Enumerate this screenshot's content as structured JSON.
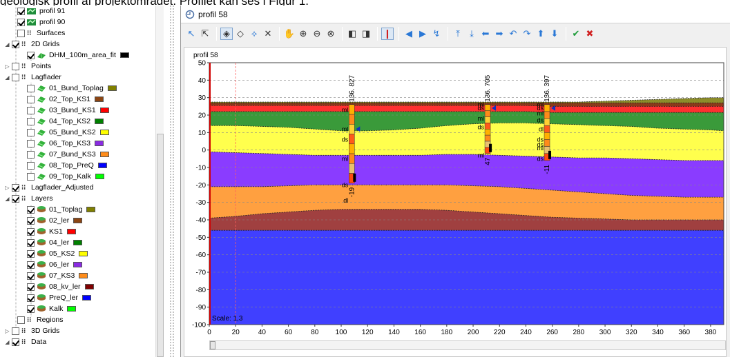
{
  "document": {
    "text": "geologisk profil af projektområdet. Profilet kan ses i Figur 1."
  },
  "tree": {
    "items": [
      {
        "key": "profil91",
        "label": "profil 91",
        "indent": 26,
        "checked": true,
        "icon": "profile-icon",
        "expander": ""
      },
      {
        "key": "profil90",
        "label": "profil 90",
        "indent": 26,
        "checked": true,
        "icon": "profile-icon",
        "expander": ""
      },
      {
        "key": "surfaces",
        "label": "Surfaces",
        "indent": 26,
        "checked": false,
        "icon": "folder-icon",
        "expander": ""
      },
      {
        "key": "grids2d",
        "label": "2D Grids",
        "indent": 18,
        "checked": true,
        "icon": "folder-icon",
        "expander": "◢"
      },
      {
        "key": "dhm",
        "label": "DHM_100m_area_fit",
        "indent": 40,
        "checked": true,
        "icon": "grid-icon",
        "expander": "",
        "swatch": "#000000"
      },
      {
        "key": "points",
        "label": "Points",
        "indent": 18,
        "checked": false,
        "icon": "folder-icon",
        "expander": "▷"
      },
      {
        "key": "lagflader",
        "label": "Lagflader",
        "indent": 18,
        "checked": false,
        "icon": "folder-icon",
        "expander": "◢"
      },
      {
        "key": "l01",
        "label": "01_Bund_Toplag",
        "indent": 40,
        "checked": false,
        "icon": "surface-icon",
        "expander": "",
        "swatch": "#808000"
      },
      {
        "key": "l02",
        "label": "02_Top_KS1",
        "indent": 40,
        "checked": false,
        "icon": "surface-icon",
        "expander": "",
        "swatch": "#8b4513"
      },
      {
        "key": "l03",
        "label": "03_Bund_KS1",
        "indent": 40,
        "checked": false,
        "icon": "surface-icon",
        "expander": "",
        "swatch": "#ff0000"
      },
      {
        "key": "l04",
        "label": "04_Top_KS2",
        "indent": 40,
        "checked": false,
        "icon": "surface-icon",
        "expander": "",
        "swatch": "#008000"
      },
      {
        "key": "l05",
        "label": "05_Bund_KS2",
        "indent": 40,
        "checked": false,
        "icon": "surface-icon",
        "expander": "",
        "swatch": "#ffff00"
      },
      {
        "key": "l06",
        "label": "06_Top_KS3",
        "indent": 40,
        "checked": false,
        "icon": "surface-icon",
        "expander": "",
        "swatch": "#8a2be2"
      },
      {
        "key": "l07",
        "label": "07_Bund_KS3",
        "indent": 40,
        "checked": false,
        "icon": "surface-icon",
        "expander": "",
        "swatch": "#ff8c1a"
      },
      {
        "key": "l08",
        "label": "08_Top_PreQ",
        "indent": 40,
        "checked": false,
        "icon": "surface-icon",
        "expander": "",
        "swatch": "#0000ff"
      },
      {
        "key": "l09",
        "label": "09_Top_Kalk",
        "indent": 40,
        "checked": false,
        "icon": "surface-icon",
        "expander": "",
        "swatch": "#00ff00"
      },
      {
        "key": "lagadj",
        "label": "Lagflader_Adjusted",
        "indent": 18,
        "checked": true,
        "icon": "folder-icon",
        "expander": "▷"
      },
      {
        "key": "layers",
        "label": "Layers",
        "indent": 18,
        "checked": true,
        "icon": "folder-icon",
        "expander": "◢"
      },
      {
        "key": "y01",
        "label": "01_Toplag",
        "indent": 40,
        "checked": true,
        "icon": "layer-icon",
        "expander": "",
        "swatch": "#808000"
      },
      {
        "key": "y02",
        "label": "02_ler",
        "indent": 40,
        "checked": true,
        "icon": "layer-icon",
        "expander": "",
        "swatch": "#8b4513"
      },
      {
        "key": "y03",
        "label": "KS1",
        "indent": 40,
        "checked": true,
        "icon": "layer-icon",
        "expander": "",
        "swatch": "#ff0000"
      },
      {
        "key": "y04",
        "label": "04_ler",
        "indent": 40,
        "checked": true,
        "icon": "layer-icon",
        "expander": "",
        "swatch": "#008000"
      },
      {
        "key": "y05",
        "label": "05_KS2",
        "indent": 40,
        "checked": true,
        "icon": "layer-icon",
        "expander": "",
        "swatch": "#ffff00"
      },
      {
        "key": "y06",
        "label": "06_ler",
        "indent": 40,
        "checked": true,
        "icon": "layer-icon",
        "expander": "",
        "swatch": "#8a2be2"
      },
      {
        "key": "y07",
        "label": "07_KS3",
        "indent": 40,
        "checked": true,
        "icon": "layer-icon",
        "expander": "",
        "swatch": "#ff8c1a"
      },
      {
        "key": "y08",
        "label": "08_kv_ler",
        "indent": 40,
        "checked": true,
        "icon": "layer-icon",
        "expander": "",
        "swatch": "#800000"
      },
      {
        "key": "y09",
        "label": "PreQ_ler",
        "indent": 40,
        "checked": true,
        "icon": "layer-icon",
        "expander": "",
        "swatch": "#0000ff"
      },
      {
        "key": "y10",
        "label": "Kalk",
        "indent": 40,
        "checked": true,
        "icon": "layer-icon",
        "expander": "",
        "swatch": "#00ff00"
      },
      {
        "key": "regions",
        "label": "Regions",
        "indent": 26,
        "checked": false,
        "icon": "folder-icon",
        "expander": ""
      },
      {
        "key": "grids3d",
        "label": "3D Grids",
        "indent": 18,
        "checked": false,
        "icon": "folder-icon",
        "expander": "▷"
      },
      {
        "key": "data",
        "label": "Data",
        "indent": 18,
        "checked": true,
        "icon": "folder-icon",
        "expander": "◢"
      }
    ]
  },
  "panel": {
    "title": "profil 58",
    "toolbar": [
      {
        "name": "select-arrow-icon",
        "glyph": "↖",
        "active": false
      },
      {
        "name": "select-detail-icon",
        "glyph": "⇱",
        "active": false
      },
      {
        "sep": true
      },
      {
        "name": "edit-node-icon",
        "glyph": "◈",
        "active": true
      },
      {
        "name": "add-node-icon",
        "glyph": "◇",
        "active": false
      },
      {
        "name": "move-node-icon",
        "glyph": "⟡",
        "active": false
      },
      {
        "name": "delete-icon",
        "glyph": "✕",
        "active": false
      },
      {
        "sep": true
      },
      {
        "name": "pan-hand-icon",
        "glyph": "✋",
        "active": false
      },
      {
        "name": "zoom-in-icon",
        "glyph": "⊕",
        "active": false
      },
      {
        "name": "zoom-out-icon",
        "glyph": "⊖",
        "active": false
      },
      {
        "name": "zoom-extent-icon",
        "glyph": "⊗",
        "active": false
      },
      {
        "sep": true
      },
      {
        "name": "previous-view-icon",
        "glyph": "◧",
        "active": false
      },
      {
        "name": "next-view-icon",
        "glyph": "◨",
        "active": false
      },
      {
        "sep": true
      },
      {
        "name": "borehole-toggle-icon",
        "glyph": "❙",
        "active": true
      },
      {
        "sep": true
      },
      {
        "name": "step-left-icon",
        "glyph": "◀",
        "active": false
      },
      {
        "name": "step-right-icon",
        "glyph": "▶",
        "active": false
      },
      {
        "name": "snap-icon",
        "glyph": "↯",
        "active": false
      },
      {
        "sep": true
      },
      {
        "name": "move-top-icon",
        "glyph": "⤒",
        "active": false
      },
      {
        "name": "move-bottom-icon",
        "glyph": "⤓",
        "active": false
      },
      {
        "name": "arrow-left-icon",
        "glyph": "⬅",
        "active": false
      },
      {
        "name": "arrow-right-icon",
        "glyph": "➡",
        "active": false
      },
      {
        "name": "undo-icon",
        "glyph": "↶",
        "active": false
      },
      {
        "name": "redo-icon",
        "glyph": "↷",
        "active": false
      },
      {
        "name": "arrow-up-icon",
        "glyph": "⬆",
        "active": false
      },
      {
        "name": "arrow-down-icon",
        "glyph": "⬇",
        "active": false
      },
      {
        "sep": true
      },
      {
        "name": "ok-icon",
        "glyph": "✔",
        "active": false
      },
      {
        "name": "cancel-icon",
        "glyph": "✖",
        "active": false
      }
    ]
  },
  "chart_data": {
    "type": "area",
    "title": "profil 58",
    "scale_label": "Scale: 1,3",
    "xlim": [
      0,
      390
    ],
    "ylim": [
      -100,
      50
    ],
    "xticks": [
      0,
      20,
      40,
      60,
      80,
      100,
      120,
      140,
      160,
      180,
      200,
      220,
      240,
      260,
      280,
      300,
      320,
      340,
      360,
      380
    ],
    "yticks": [
      50,
      40,
      30,
      20,
      10,
      0,
      -10,
      -20,
      -30,
      -40,
      -50,
      -60,
      -70,
      -80,
      -90,
      -100
    ],
    "grid": "dashed-horizontal",
    "x_profile": [
      0,
      20,
      40,
      60,
      80,
      100,
      120,
      140,
      160,
      180,
      200,
      220,
      240,
      260,
      280,
      300,
      320,
      340,
      360,
      380,
      390
    ],
    "layers": [
      {
        "name": "01_Toplag",
        "color": "#8c8c2a",
        "top": [
          27.5,
          27.5,
          27.5,
          27.5,
          27.5,
          27.5,
          27.5,
          27.5,
          27.5,
          27.5,
          27.5,
          27.5,
          27.5,
          27.5,
          27.5,
          28,
          28.5,
          29,
          29.5,
          30,
          30
        ]
      },
      {
        "name": "02_ler",
        "color": "#8b3a1a",
        "top": [
          27,
          27,
          27,
          27,
          27,
          27,
          27,
          27,
          27,
          27,
          27,
          27,
          27,
          27,
          27,
          27,
          27,
          27,
          27,
          27,
          27
        ]
      },
      {
        "name": "KS1",
        "color": "#ff3030",
        "top": [
          25.5,
          25.5,
          25.5,
          25.5,
          25.5,
          25.5,
          25.5,
          25.5,
          25.5,
          25.5,
          25.5,
          25.5,
          25.5,
          25,
          25,
          25,
          25,
          25,
          25,
          25,
          25
        ]
      },
      {
        "name": "04_ler",
        "color": "#3a9a3a",
        "top": [
          22,
          22,
          22,
          22,
          22,
          22,
          22,
          22,
          22,
          22,
          22,
          22,
          22,
          21.5,
          21.5,
          21.5,
          21.5,
          21.5,
          21.5,
          21.5,
          21.5
        ]
      },
      {
        "name": "05_KS2",
        "color": "#ffff4d",
        "top": [
          14,
          14,
          13.5,
          13,
          12,
          11,
          11,
          11.5,
          12.5,
          14,
          15,
          15.5,
          15.5,
          15,
          14.5,
          14,
          13.5,
          12.5,
          12,
          11.5,
          11
        ]
      },
      {
        "name": "06_ler",
        "color": "#8a3cff",
        "top": [
          -1,
          -1.5,
          -2,
          -2.5,
          -3,
          -3,
          -3,
          -3,
          -3,
          -2.5,
          -2.5,
          -3,
          -3.5,
          -4,
          -4.5,
          -4.5,
          -5,
          -5.5,
          -6,
          -6,
          -6
        ]
      },
      {
        "name": "07_KS3",
        "color": "#ffa040",
        "top": [
          -21,
          -21,
          -21,
          -20.5,
          -20,
          -20,
          -20,
          -20,
          -20,
          -20,
          -20.5,
          -21,
          -22,
          -23,
          -24,
          -25,
          -26,
          -26.5,
          -27,
          -27,
          -27
        ]
      },
      {
        "name": "08_kv_ler",
        "color": "#a04040",
        "top": [
          -39,
          -38,
          -36.5,
          -35.5,
          -34.5,
          -34,
          -34,
          -34,
          -34,
          -34.5,
          -35.5,
          -36.5,
          -37.5,
          -38.5,
          -39,
          -39.5,
          -40,
          -40,
          -40,
          -40,
          -40
        ]
      },
      {
        "name": "PreQ_ler",
        "color": "#4040ff",
        "top": [
          -46,
          -46,
          -46,
          -46,
          -46,
          -46,
          -46,
          -46,
          -46,
          -46,
          -46,
          -46,
          -46,
          -46,
          -46,
          -46,
          -46,
          -46,
          -46,
          -46,
          -46
        ]
      }
    ],
    "boreholes": [
      {
        "id": "136. 827",
        "x": 108,
        "top": 26,
        "bottom": -19,
        "bottom_label": "-19",
        "labels": [
          {
            "t": "ml",
            "y": 23
          },
          {
            "t": "ml",
            "y": 12
          },
          {
            "t": "ds",
            "y": 6
          },
          {
            "t": "ml",
            "y": -5
          },
          {
            "t": "ds",
            "y": -20
          },
          {
            "t": "dl",
            "y": -29
          }
        ]
      },
      {
        "id": "136. 705",
        "x": 211,
        "top": 26,
        "bottom": -2,
        "bottom_label": "47",
        "labels": [
          {
            "t": "ml",
            "y": 26
          },
          {
            "t": "ds",
            "y": 24
          },
          {
            "t": "ml",
            "y": 18
          },
          {
            "t": "ds",
            "y": 13
          },
          {
            "t": "ml",
            "y": -3
          }
        ]
      },
      {
        "id": "136. 397",
        "x": 256,
        "top": 26,
        "bottom": -6,
        "bottom_label": "-11",
        "labels": [
          {
            "t": "ml",
            "y": 26
          },
          {
            "t": "ds",
            "y": 24
          },
          {
            "t": "ml",
            "y": 21
          },
          {
            "t": "ds",
            "y": 17
          },
          {
            "t": "dl",
            "y": 12
          },
          {
            "t": "ds",
            "y": 6
          },
          {
            "t": "ds",
            "y": 3
          },
          {
            "t": "ml",
            "y": 1
          },
          {
            "t": "ds",
            "y": -5
          }
        ]
      }
    ]
  }
}
